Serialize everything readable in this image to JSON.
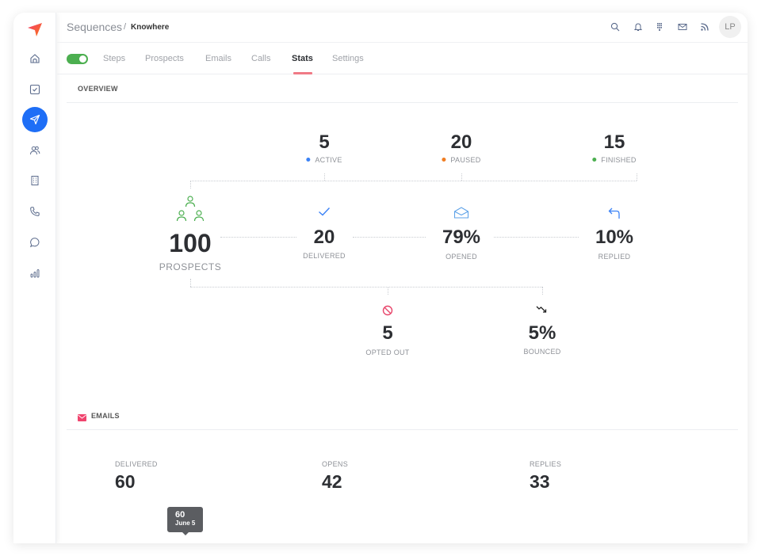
{
  "header": {
    "breadcrumb_root": "Sequences",
    "breadcrumb_sep": "/",
    "breadcrumb_current": "Knowhere",
    "avatar_initials": "LP",
    "icons": [
      "search-icon",
      "bell-icon",
      "dialpad-icon",
      "mail-icon",
      "rss-icon"
    ]
  },
  "sidebar": {
    "items": [
      {
        "name": "home",
        "icon": "home-icon"
      },
      {
        "name": "tasks",
        "icon": "checkbox-icon"
      },
      {
        "name": "sequences",
        "icon": "send-icon",
        "active": true
      },
      {
        "name": "people",
        "icon": "users-icon"
      },
      {
        "name": "companies",
        "icon": "building-icon"
      },
      {
        "name": "calls",
        "icon": "phone-icon"
      },
      {
        "name": "chat",
        "icon": "chat-icon"
      },
      {
        "name": "reports",
        "icon": "bar-chart-icon"
      }
    ]
  },
  "tabs": {
    "enabled": true,
    "items": [
      "Steps",
      "Prospects",
      "Emails",
      "Calls",
      "Stats",
      "Settings"
    ],
    "active": "Stats"
  },
  "overview": {
    "title": "OVERVIEW",
    "status": [
      {
        "value": "5",
        "label": "ACTIVE",
        "color": "#3b82f6"
      },
      {
        "value": "20",
        "label": "PAUSED",
        "color": "#f07d22"
      },
      {
        "value": "15",
        "label": "FINISHED",
        "color": "#4caf50"
      }
    ],
    "prospects": {
      "value": "100",
      "label": "PROSPECTS",
      "color": "#4caf50"
    },
    "funnel": [
      {
        "value": "20",
        "label": "DELIVERED",
        "icon": "check-icon",
        "color": "#3b82f6"
      },
      {
        "value": "79%",
        "label": "OPENED",
        "icon": "envelope-open-icon",
        "color": "#5fa3e8"
      },
      {
        "value": "10%",
        "label": "REPLIED",
        "icon": "reply-icon",
        "color": "#3b82f6"
      }
    ],
    "negative": [
      {
        "value": "5",
        "label": "OPTED OUT",
        "icon": "block-icon",
        "color": "#e8476c"
      },
      {
        "value": "5%",
        "label": "BOUNCED",
        "icon": "trend-down-icon",
        "color": "#222222"
      }
    ]
  },
  "emails": {
    "title": "EMAILS",
    "icon_color": "#f0446e",
    "metrics": [
      {
        "label": "DELIVERED",
        "value": "60"
      },
      {
        "label": "OPENS",
        "value": "42"
      },
      {
        "label": "REPLIES",
        "value": "33"
      }
    ],
    "tooltip": {
      "value": "60",
      "date": "June 5"
    }
  }
}
